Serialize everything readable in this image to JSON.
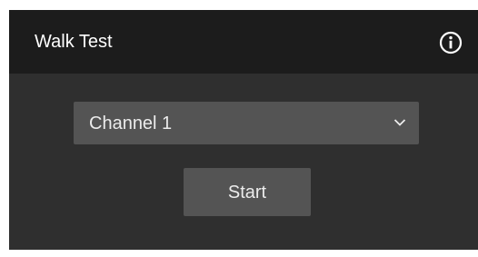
{
  "panel": {
    "title": "Walk Test",
    "info_icon": "info-circle-icon"
  },
  "channel_select": {
    "selected": "Channel 1",
    "chevron_icon": "chevron-down-icon"
  },
  "start_button": {
    "label": "Start"
  },
  "colors": {
    "panel_background": "#2f2f2f",
    "header_background": "#1c1c1c",
    "control_background": "#545454",
    "text": "#ececec"
  }
}
